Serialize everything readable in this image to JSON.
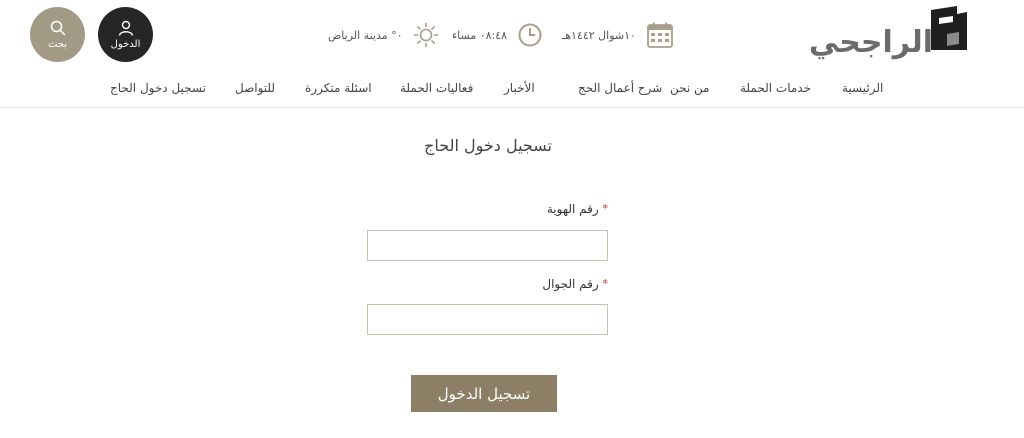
{
  "header": {
    "search_label": "بحث",
    "login_label": "الدخول",
    "weather": "٠° مدينة الرياض",
    "time": "٠٨:٤٨ مساء",
    "date": "١٠شوال ١٤٤٢هـ",
    "logo_text": "الراجحي",
    "accent_color": "#8c7f66"
  },
  "nav": {
    "items": [
      "الرئيسية",
      "خدمات الحملة",
      "من نحن",
      "شرح أعمال الحج",
      "الأخبار",
      "فعاليات الحملة",
      "اسئلة متكررة",
      "للتواصل",
      "تسجيل دخول الحاج"
    ]
  },
  "form": {
    "title": "تسجيل دخول الحاج",
    "id_label": "رقم الهوية",
    "id_value": "",
    "mobile_label": "رقم الجوال",
    "mobile_value": "",
    "required_mark": "*",
    "submit_label": "تسجيل الدخول"
  }
}
